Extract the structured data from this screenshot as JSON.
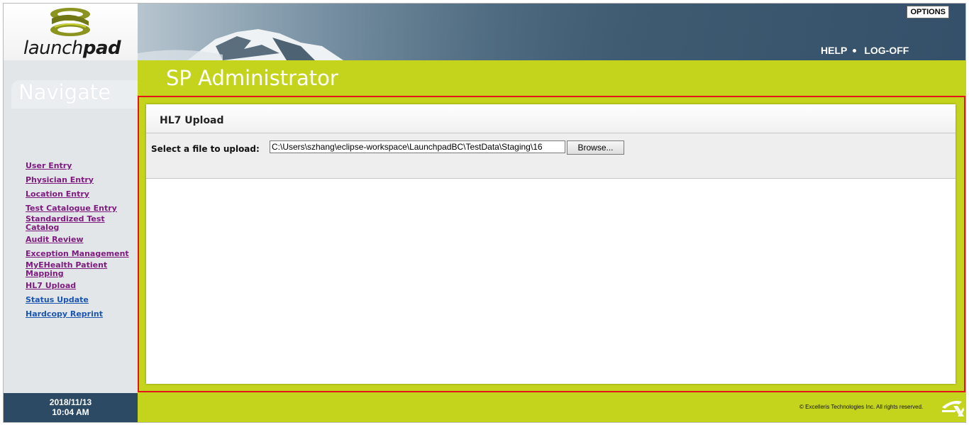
{
  "logo": {
    "light": "launch",
    "bold": "pad"
  },
  "header": {
    "options_label": "OPTIONS",
    "help_label": "HELP",
    "logoff_label": "LOG-OFF"
  },
  "page_title": "SP Administrator",
  "sidebar": {
    "heading": "Navigate",
    "items": [
      {
        "label": "User Entry"
      },
      {
        "label": "Physician Entry"
      },
      {
        "label": "Location Entry"
      },
      {
        "label": "Test Catalogue Entry"
      },
      {
        "label": "Standardized Test Catalog"
      },
      {
        "label": "Audit Review"
      },
      {
        "label": "Exception Management"
      },
      {
        "label": "MyEHealth Patient Mapping"
      },
      {
        "label": "HL7 Upload"
      },
      {
        "label": "Status Update"
      },
      {
        "label": "Hardcopy Reprint"
      }
    ],
    "date": "2018/11/13",
    "time": "10:04 AM"
  },
  "panel": {
    "heading": "HL7 Upload",
    "file_label": "Select a file to upload:",
    "file_value": "C:\\Users\\szhang\\eclipse-workspace\\LaunchpadBC\\TestData\\Staging\\16",
    "browse_label": "Browse..."
  },
  "footer": {
    "copyright": "© Excelleris Technologies Inc. All rights reserved."
  },
  "colors": {
    "accent_green": "#c4d41c",
    "highlight_red": "#e3141c",
    "link_visited": "#7d1a7d",
    "link": "#1a55b0",
    "date_bg": "#2d4a64"
  }
}
